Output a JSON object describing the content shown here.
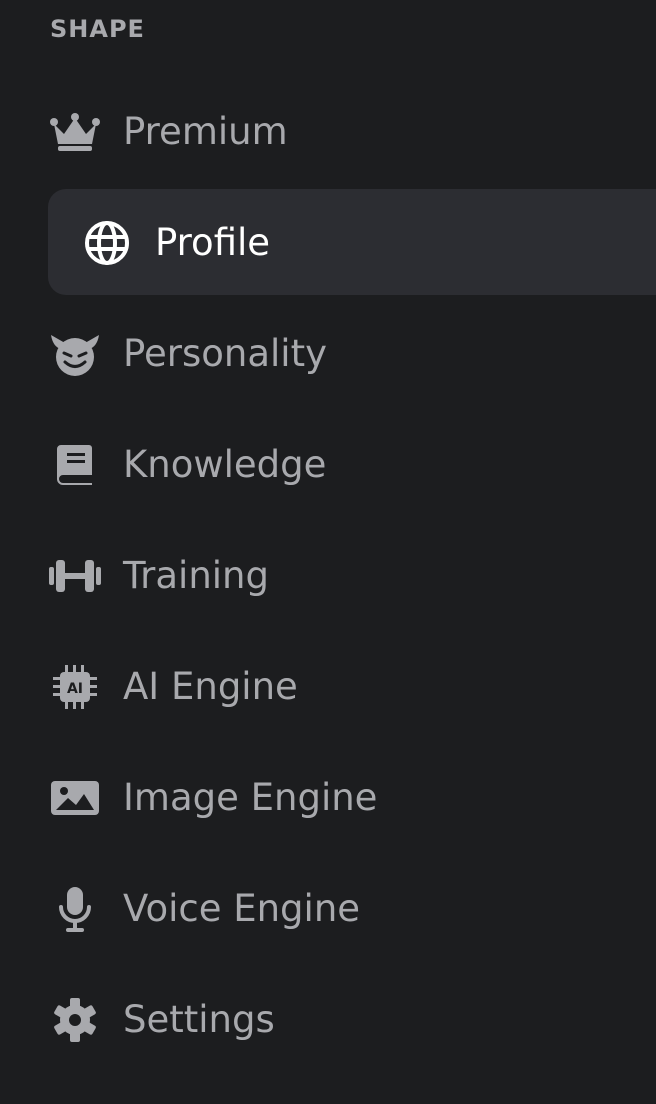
{
  "sidebar": {
    "section_label": "SHAPE",
    "active_index": 1,
    "items": [
      {
        "label": "Premium",
        "icon": "crown-icon"
      },
      {
        "label": "Profile",
        "icon": "globe-icon"
      },
      {
        "label": "Personality",
        "icon": "devil-face-icon"
      },
      {
        "label": "Knowledge",
        "icon": "book-icon"
      },
      {
        "label": "Training",
        "icon": "dumbbell-icon"
      },
      {
        "label": "AI Engine",
        "icon": "ai-chip-icon"
      },
      {
        "label": "Image Engine",
        "icon": "image-icon"
      },
      {
        "label": "Voice Engine",
        "icon": "microphone-icon"
      },
      {
        "label": "Settings",
        "icon": "gear-icon"
      }
    ]
  },
  "colors": {
    "background": "#1c1d1f",
    "active_background": "#2c2d32",
    "text_muted": "#a8a9ad",
    "text_active": "#ffffff"
  }
}
